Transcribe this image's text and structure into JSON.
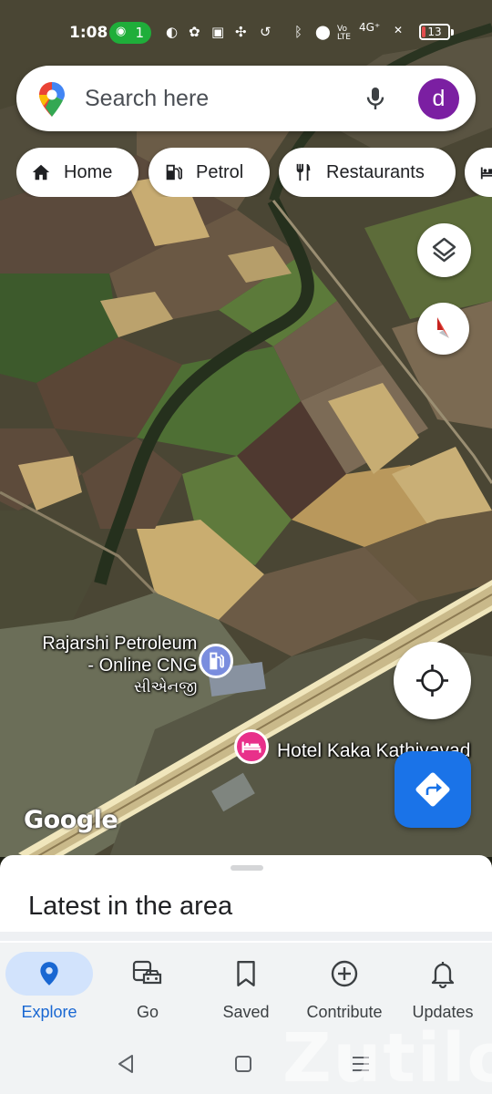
{
  "status": {
    "time": "1:08",
    "hotspot_count": "1",
    "network": "4G⁺",
    "battery": "13",
    "battery_level": 0.13
  },
  "search": {
    "placeholder": "Search here",
    "avatar_letter": "d"
  },
  "chips": [
    {
      "label": "Home",
      "icon": "home-icon"
    },
    {
      "label": "Petrol",
      "icon": "gas-station-icon"
    },
    {
      "label": "Restaurants",
      "icon": "fork-knife-icon"
    },
    {
      "label": "",
      "icon": "hotel-icon"
    }
  ],
  "map": {
    "places": [
      {
        "name_line1": "Rajarshi Petroleum",
        "name_line2": "- Online CNG",
        "name_line3": "સીએનજી",
        "icon": "gas-station-icon",
        "color": "#7a8dde"
      },
      {
        "name": "Hotel Kaka Kathiyavad",
        "icon": "hotel-icon",
        "color": "#e8308a"
      }
    ],
    "attribution": "Google"
  },
  "sheet": {
    "title": "Latest in the area"
  },
  "nav": [
    {
      "label": "Explore",
      "icon": "explore-pin-icon",
      "active": true
    },
    {
      "label": "Go",
      "icon": "commute-icon",
      "active": false
    },
    {
      "label": "Saved",
      "icon": "bookmark-icon",
      "active": false
    },
    {
      "label": "Contribute",
      "icon": "add-circle-icon",
      "active": false
    },
    {
      "label": "Updates",
      "icon": "bell-icon",
      "active": false
    }
  ],
  "colors": {
    "accent": "#1a73e8",
    "avatar": "#7b1fa2",
    "nav_active_bg": "#d2e3fc",
    "nav_active_text": "#1967d2"
  },
  "watermark": "Zutilo"
}
